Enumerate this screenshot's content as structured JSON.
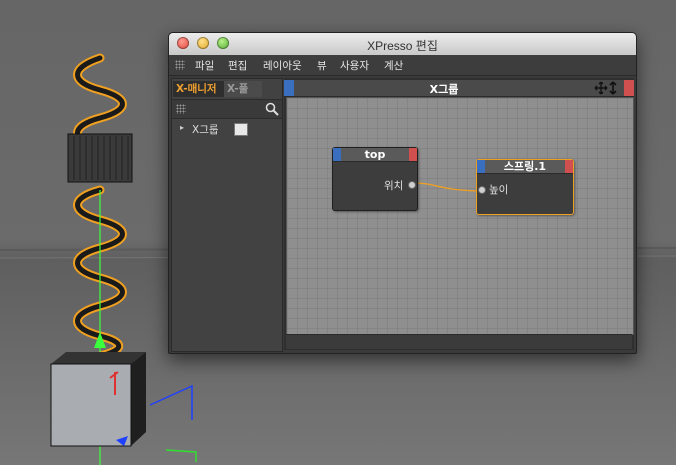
{
  "window": {
    "title": "XPresso 편집"
  },
  "menu": {
    "items": [
      "파일",
      "편집",
      "레이아웃",
      "뷰",
      "사용자",
      "계산"
    ]
  },
  "manager": {
    "tabs": [
      "X-매니저",
      "X-풀"
    ],
    "tree": {
      "label": "X그룹"
    }
  },
  "editor": {
    "group_title": "X그룹",
    "nodes": {
      "top": {
        "title": "top",
        "output_port": "위치"
      },
      "spring": {
        "title": "스프링.1",
        "input_port": "높이"
      }
    }
  },
  "colors": {
    "accent_orange": "#f0a020",
    "port_blue": "#3a6fc0",
    "port_red": "#d05050",
    "wire": "#f0a020"
  },
  "icons": {
    "search": "search-icon",
    "move": "move-icon",
    "tree_arrow": "chevron-right-icon",
    "node_icon": "xpresso-node-icon"
  }
}
